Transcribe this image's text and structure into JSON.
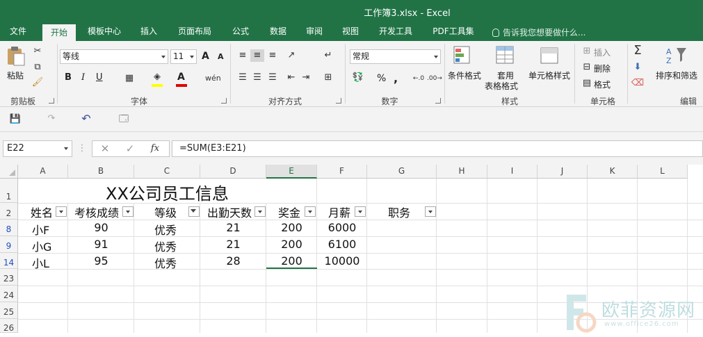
{
  "window": {
    "title": "工作簿3.xlsx - Excel"
  },
  "tabs": [
    "文件",
    "开始",
    "模板中心",
    "插入",
    "页面布局",
    "公式",
    "数据",
    "审阅",
    "视图",
    "开发工具",
    "PDF工具集"
  ],
  "active_tab": "开始",
  "tell_me": "告诉我您想要做什么...",
  "ribbon": {
    "clipboard": {
      "paste": "粘贴",
      "label": "剪贴板"
    },
    "font": {
      "name": "等线",
      "size": "11",
      "bold": "B",
      "italic": "I",
      "underline": "U",
      "grow": "A",
      "shrink": "A",
      "label": "字体"
    },
    "alignment": {
      "label": "对齐方式"
    },
    "number": {
      "format": "常规",
      "percent": "%",
      "comma": ",",
      "label": "数字"
    },
    "styles": {
      "conditional": "条件格式",
      "table_format_1": "套用",
      "table_format_2": "表格格式",
      "cell_styles": "单元格样式",
      "label": "样式"
    },
    "cells": {
      "insert": "插入",
      "delete": "删除",
      "format": "格式",
      "label": "单元格"
    },
    "editing": {
      "sort_filter": "排序和筛选",
      "label": "编辑"
    }
  },
  "formula_bar": {
    "name_box": "E22",
    "fx": "fx",
    "formula": "=SUM(E3:E21)"
  },
  "grid": {
    "columns": [
      "A",
      "B",
      "C",
      "D",
      "E",
      "F",
      "G",
      "H",
      "I",
      "J",
      "K",
      "L"
    ],
    "selected_column": "E",
    "rows": [
      "1",
      "2",
      "8",
      "9",
      "14",
      "23",
      "24",
      "25",
      "26"
    ],
    "title": "XX公司员工信息",
    "headers": [
      "姓名",
      "考核成绩",
      "等级",
      "出勤天数",
      "奖金",
      "月薪",
      "职务"
    ],
    "data": [
      [
        "小F",
        "90",
        "优秀",
        "21",
        "200",
        "6000"
      ],
      [
        "小G",
        "91",
        "优秀",
        "21",
        "200",
        "6100"
      ],
      [
        "小L",
        "95",
        "优秀",
        "28",
        "200",
        "10000"
      ]
    ]
  },
  "watermark": {
    "text": "欧菲资源网",
    "url": "www.office26.com"
  },
  "colors": {
    "accent": "#217346",
    "filtered_row": "#1f4fbf"
  }
}
